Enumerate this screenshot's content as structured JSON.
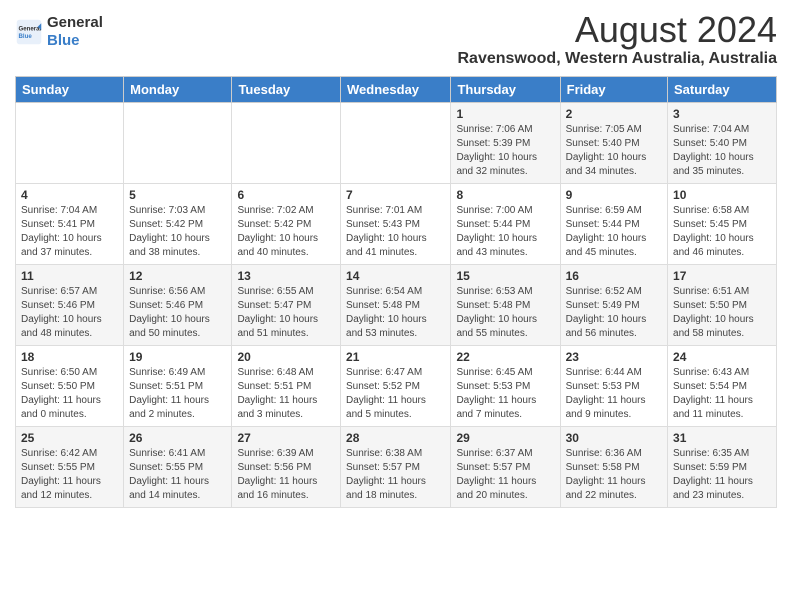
{
  "header": {
    "logo_general": "General",
    "logo_blue": "Blue",
    "main_title": "August 2024",
    "subtitle": "Ravenswood, Western Australia, Australia"
  },
  "weekdays": [
    "Sunday",
    "Monday",
    "Tuesday",
    "Wednesday",
    "Thursday",
    "Friday",
    "Saturday"
  ],
  "weeks": [
    [
      {
        "day": "",
        "info": ""
      },
      {
        "day": "",
        "info": ""
      },
      {
        "day": "",
        "info": ""
      },
      {
        "day": "",
        "info": ""
      },
      {
        "day": "1",
        "info": "Sunrise: 7:06 AM\nSunset: 5:39 PM\nDaylight: 10 hours\nand 32 minutes."
      },
      {
        "day": "2",
        "info": "Sunrise: 7:05 AM\nSunset: 5:40 PM\nDaylight: 10 hours\nand 34 minutes."
      },
      {
        "day": "3",
        "info": "Sunrise: 7:04 AM\nSunset: 5:40 PM\nDaylight: 10 hours\nand 35 minutes."
      }
    ],
    [
      {
        "day": "4",
        "info": "Sunrise: 7:04 AM\nSunset: 5:41 PM\nDaylight: 10 hours\nand 37 minutes."
      },
      {
        "day": "5",
        "info": "Sunrise: 7:03 AM\nSunset: 5:42 PM\nDaylight: 10 hours\nand 38 minutes."
      },
      {
        "day": "6",
        "info": "Sunrise: 7:02 AM\nSunset: 5:42 PM\nDaylight: 10 hours\nand 40 minutes."
      },
      {
        "day": "7",
        "info": "Sunrise: 7:01 AM\nSunset: 5:43 PM\nDaylight: 10 hours\nand 41 minutes."
      },
      {
        "day": "8",
        "info": "Sunrise: 7:00 AM\nSunset: 5:44 PM\nDaylight: 10 hours\nand 43 minutes."
      },
      {
        "day": "9",
        "info": "Sunrise: 6:59 AM\nSunset: 5:44 PM\nDaylight: 10 hours\nand 45 minutes."
      },
      {
        "day": "10",
        "info": "Sunrise: 6:58 AM\nSunset: 5:45 PM\nDaylight: 10 hours\nand 46 minutes."
      }
    ],
    [
      {
        "day": "11",
        "info": "Sunrise: 6:57 AM\nSunset: 5:46 PM\nDaylight: 10 hours\nand 48 minutes."
      },
      {
        "day": "12",
        "info": "Sunrise: 6:56 AM\nSunset: 5:46 PM\nDaylight: 10 hours\nand 50 minutes."
      },
      {
        "day": "13",
        "info": "Sunrise: 6:55 AM\nSunset: 5:47 PM\nDaylight: 10 hours\nand 51 minutes."
      },
      {
        "day": "14",
        "info": "Sunrise: 6:54 AM\nSunset: 5:48 PM\nDaylight: 10 hours\nand 53 minutes."
      },
      {
        "day": "15",
        "info": "Sunrise: 6:53 AM\nSunset: 5:48 PM\nDaylight: 10 hours\nand 55 minutes."
      },
      {
        "day": "16",
        "info": "Sunrise: 6:52 AM\nSunset: 5:49 PM\nDaylight: 10 hours\nand 56 minutes."
      },
      {
        "day": "17",
        "info": "Sunrise: 6:51 AM\nSunset: 5:50 PM\nDaylight: 10 hours\nand 58 minutes."
      }
    ],
    [
      {
        "day": "18",
        "info": "Sunrise: 6:50 AM\nSunset: 5:50 PM\nDaylight: 11 hours\nand 0 minutes."
      },
      {
        "day": "19",
        "info": "Sunrise: 6:49 AM\nSunset: 5:51 PM\nDaylight: 11 hours\nand 2 minutes."
      },
      {
        "day": "20",
        "info": "Sunrise: 6:48 AM\nSunset: 5:51 PM\nDaylight: 11 hours\nand 3 minutes."
      },
      {
        "day": "21",
        "info": "Sunrise: 6:47 AM\nSunset: 5:52 PM\nDaylight: 11 hours\nand 5 minutes."
      },
      {
        "day": "22",
        "info": "Sunrise: 6:45 AM\nSunset: 5:53 PM\nDaylight: 11 hours\nand 7 minutes."
      },
      {
        "day": "23",
        "info": "Sunrise: 6:44 AM\nSunset: 5:53 PM\nDaylight: 11 hours\nand 9 minutes."
      },
      {
        "day": "24",
        "info": "Sunrise: 6:43 AM\nSunset: 5:54 PM\nDaylight: 11 hours\nand 11 minutes."
      }
    ],
    [
      {
        "day": "25",
        "info": "Sunrise: 6:42 AM\nSunset: 5:55 PM\nDaylight: 11 hours\nand 12 minutes."
      },
      {
        "day": "26",
        "info": "Sunrise: 6:41 AM\nSunset: 5:55 PM\nDaylight: 11 hours\nand 14 minutes."
      },
      {
        "day": "27",
        "info": "Sunrise: 6:39 AM\nSunset: 5:56 PM\nDaylight: 11 hours\nand 16 minutes."
      },
      {
        "day": "28",
        "info": "Sunrise: 6:38 AM\nSunset: 5:57 PM\nDaylight: 11 hours\nand 18 minutes."
      },
      {
        "day": "29",
        "info": "Sunrise: 6:37 AM\nSunset: 5:57 PM\nDaylight: 11 hours\nand 20 minutes."
      },
      {
        "day": "30",
        "info": "Sunrise: 6:36 AM\nSunset: 5:58 PM\nDaylight: 11 hours\nand 22 minutes."
      },
      {
        "day": "31",
        "info": "Sunrise: 6:35 AM\nSunset: 5:59 PM\nDaylight: 11 hours\nand 23 minutes."
      }
    ]
  ]
}
